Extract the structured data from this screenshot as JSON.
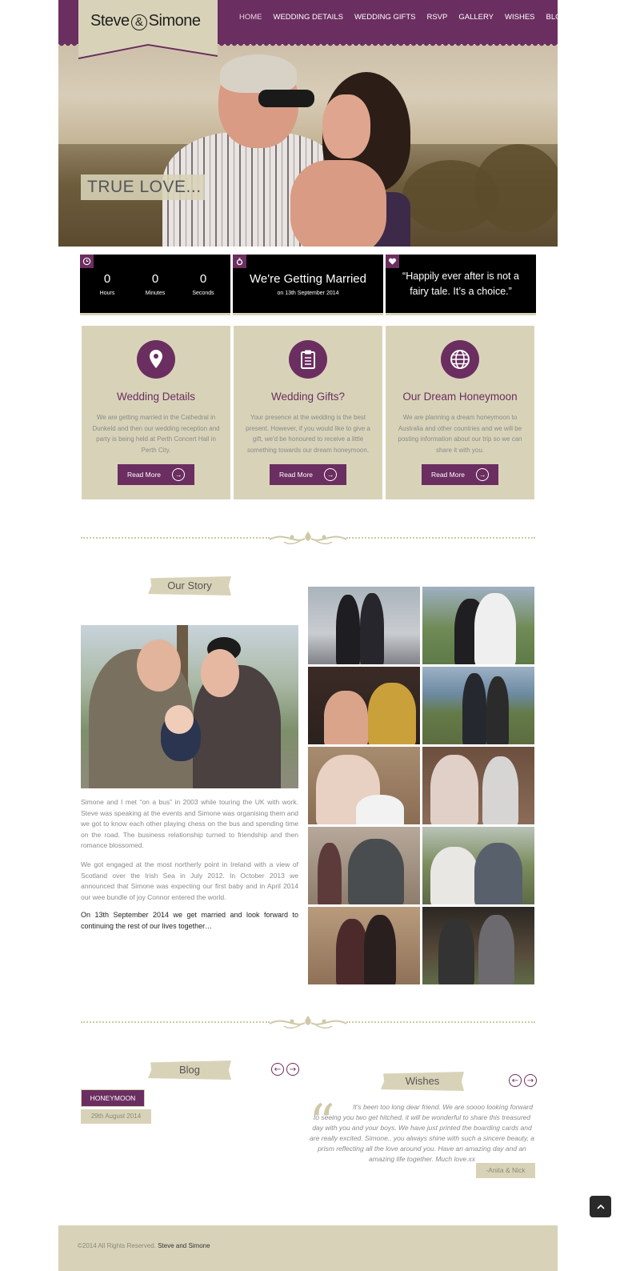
{
  "brand": {
    "name_first": "Steve",
    "amp": "&",
    "name_second": "Simone"
  },
  "nav": {
    "items": [
      "HOME",
      "WEDDING DETAILS",
      "WEDDING GIFTS",
      "RSVP",
      "GALLERY",
      "WISHES",
      "BLOG"
    ],
    "active": "HOME"
  },
  "hero": {
    "caption": "TRUE LOVE..."
  },
  "countdown": {
    "hours": "0",
    "hours_label": "Hours",
    "minutes": "0",
    "minutes_label": "Minutes",
    "seconds": "0",
    "seconds_label": "Seconds",
    "icon": "clock-icon"
  },
  "married": {
    "title": "We're Getting Married",
    "date": "on 13th September 2014",
    "icon": "ring-icon"
  },
  "quote": {
    "text": "“Happily ever after is not a fairy tale. It’s a choice.”",
    "icon": "heart-icon"
  },
  "features": [
    {
      "icon": "map-pin-icon",
      "title": "Wedding Details",
      "text": "We are getting married in the Cathedral in Dunkeld and then our wedding reception and party is being held at Perth Concert Hall in Perth City.",
      "button": "Read More"
    },
    {
      "icon": "clipboard-icon",
      "title": "Wedding Gifts?",
      "text": "Your presence at the wedding is the best present. However, if you would like to give a gift, we'd be honoured to receive a little something towards our dream honeymoon.",
      "button": "Read More"
    },
    {
      "icon": "globe-icon",
      "title": "Our Dream Honeymoon",
      "text": "We are planning a dream honeymoon to Australia and other countries and we will be posting information about our trip so we can share it with you.",
      "button": "Read More"
    }
  ],
  "story": {
    "heading": "Our Story",
    "p1": "Simone and I met “on a bus” in 2003 while touring the UK with work. Steve was speaking at the events and Simone was organising them and we got to know each other playing chess on the bus and spending time on the road. The business relationship turned to friendship and then romance blossomed.",
    "p2": "We got engaged at the most northerly point in Ireland with a view of Scotland over the Irish Sea in July 2012. In October 2013 we announced that Simone was expecting our first baby and in April 2014 our wee bundle of joy Connor entered the world.",
    "p3": "On 13th September 2014 we get married and look forward to continuing the rest of our lives together…"
  },
  "gallery": {
    "count": 10
  },
  "blog": {
    "heading": "Blog",
    "category": "HONEYMOON",
    "date": "29th August 2014"
  },
  "wishes": {
    "heading": "Wishes",
    "text": "It's been too long dear friend. We are soooo looking forward to seeing you two get hitched, it will be wonderful to share this treasured day with you and your boys. We have just printed the boarding cards and are really excited. Simone.. you always shine with such a sincere beauty, a prism reflecting all the love around you. Have an amazing day and an amazing life together. Much love.xx",
    "author": "-Anita & Nick"
  },
  "footer": {
    "copyright": "©2014 All Rights Reserved.",
    "owner": "Steve and Simone"
  },
  "colors": {
    "accent": "#6b2e60",
    "beige": "#d8d3b8",
    "black": "#000000"
  }
}
